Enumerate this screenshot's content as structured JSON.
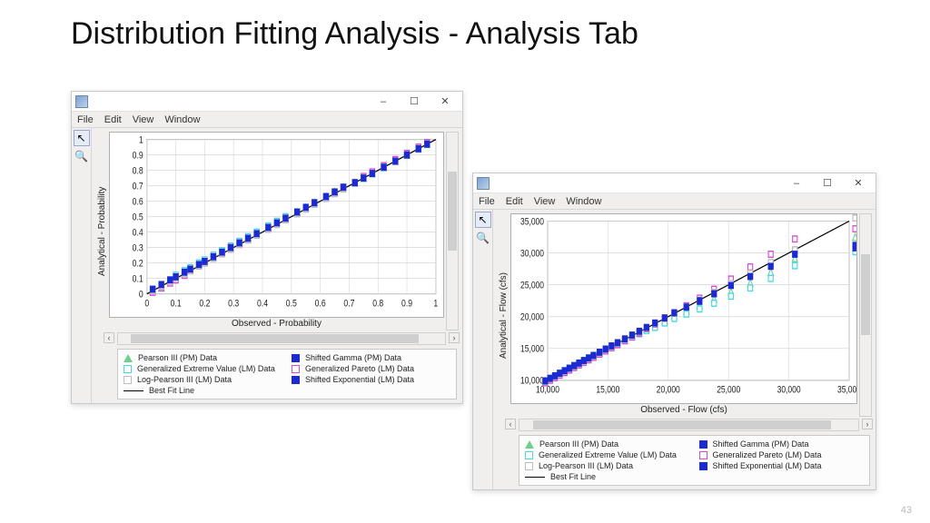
{
  "slide": {
    "title": "Distribution Fitting Analysis - Analysis Tab",
    "page": "43"
  },
  "menus": [
    "File",
    "Edit",
    "View",
    "Window"
  ],
  "winctrl": {
    "minimize": "–",
    "maximize": "☐",
    "close": "✕"
  },
  "tools": {
    "pointer_glyph": "↖",
    "zoom_glyph": "🔍"
  },
  "legend_items": [
    {
      "name": "Pearson III (PM) Data",
      "style": "tri",
      "color": "#6fd08c"
    },
    {
      "name": "Shifted Gamma (PM) Data",
      "style": "fill",
      "color": "#1c2bd1"
    },
    {
      "name": "Generalized Extreme Value (LM) Data",
      "style": "outline",
      "color": "#47d7e6"
    },
    {
      "name": "Generalized Pareto (LM) Data",
      "style": "outline",
      "color": "#d64bd1"
    },
    {
      "name": "Log-Pearson III (LM) Data",
      "style": "outline",
      "color": "#bdbdbd"
    },
    {
      "name": "Shifted Exponential (LM) Data",
      "style": "fill",
      "color": "#1c2bd1"
    }
  ],
  "bestfit_label": "Best Fit Line",
  "chart_data": [
    {
      "id": "pp_plot",
      "type": "scatter",
      "title": "",
      "xlabel": "Observed - Probability",
      "ylabel": "Analytical - Probability",
      "xlim": [
        0,
        1
      ],
      "ylim": [
        0,
        1
      ],
      "x_ticks": [
        0,
        0.1,
        0.2,
        0.3,
        0.4,
        0.5,
        0.6,
        0.7,
        0.8,
        0.9,
        1
      ],
      "y_ticks": [
        0,
        0.1,
        0.2,
        0.3,
        0.4,
        0.5,
        0.6,
        0.7,
        0.8,
        0.9,
        1.0
      ],
      "bestfit": {
        "x": [
          0,
          1
        ],
        "y": [
          0,
          1
        ]
      },
      "series": [
        {
          "name": "Pearson III (PM) Data",
          "color": "#6fd08c",
          "style": "tri",
          "x": [
            0.02,
            0.05,
            0.08,
            0.1,
            0.13,
            0.15,
            0.18,
            0.2,
            0.23,
            0.26,
            0.29,
            0.32,
            0.35,
            0.38,
            0.42,
            0.45,
            0.48,
            0.52,
            0.55,
            0.58,
            0.62,
            0.65,
            0.68,
            0.72,
            0.75,
            0.78,
            0.82,
            0.86,
            0.9,
            0.94,
            0.97
          ],
          "y": [
            0.02,
            0.04,
            0.08,
            0.1,
            0.13,
            0.16,
            0.19,
            0.21,
            0.24,
            0.27,
            0.3,
            0.33,
            0.36,
            0.39,
            0.43,
            0.46,
            0.49,
            0.53,
            0.56,
            0.59,
            0.63,
            0.66,
            0.69,
            0.72,
            0.75,
            0.78,
            0.82,
            0.86,
            0.9,
            0.94,
            0.97
          ]
        },
        {
          "name": "Shifted Gamma (PM) Data",
          "color": "#1c2bd1",
          "style": "fill",
          "x": [
            0.02,
            0.05,
            0.08,
            0.1,
            0.13,
            0.15,
            0.18,
            0.2,
            0.23,
            0.26,
            0.29,
            0.32,
            0.35,
            0.38,
            0.42,
            0.45,
            0.48,
            0.52,
            0.55,
            0.58,
            0.62,
            0.65,
            0.68,
            0.72,
            0.75,
            0.78,
            0.82,
            0.86,
            0.9,
            0.94,
            0.97
          ],
          "y": [
            0.02,
            0.05,
            0.08,
            0.11,
            0.14,
            0.16,
            0.19,
            0.21,
            0.24,
            0.27,
            0.3,
            0.33,
            0.36,
            0.39,
            0.43,
            0.46,
            0.49,
            0.53,
            0.56,
            0.59,
            0.63,
            0.66,
            0.69,
            0.72,
            0.75,
            0.78,
            0.82,
            0.86,
            0.9,
            0.94,
            0.97
          ]
        },
        {
          "name": "Generalized Extreme Value (LM) Data",
          "color": "#47d7e6",
          "style": "outline",
          "x": [
            0.02,
            0.05,
            0.08,
            0.1,
            0.13,
            0.15,
            0.18,
            0.2,
            0.23,
            0.26,
            0.29,
            0.32,
            0.35,
            0.38,
            0.42,
            0.45,
            0.48,
            0.52,
            0.55,
            0.58,
            0.62,
            0.65,
            0.68,
            0.72,
            0.75,
            0.78,
            0.82,
            0.86,
            0.9,
            0.94,
            0.97
          ],
          "y": [
            0.03,
            0.06,
            0.09,
            0.12,
            0.15,
            0.17,
            0.2,
            0.22,
            0.25,
            0.28,
            0.31,
            0.34,
            0.37,
            0.4,
            0.44,
            0.47,
            0.5,
            0.53,
            0.56,
            0.59,
            0.63,
            0.66,
            0.69,
            0.72,
            0.75,
            0.78,
            0.82,
            0.86,
            0.9,
            0.94,
            0.97
          ]
        },
        {
          "name": "Generalized Pareto (LM) Data",
          "color": "#d64bd1",
          "style": "outline",
          "x": [
            0.02,
            0.05,
            0.08,
            0.1,
            0.13,
            0.15,
            0.18,
            0.2,
            0.23,
            0.26,
            0.29,
            0.32,
            0.35,
            0.38,
            0.42,
            0.45,
            0.48,
            0.52,
            0.55,
            0.58,
            0.62,
            0.65,
            0.68,
            0.72,
            0.75,
            0.78,
            0.82,
            0.86,
            0.9,
            0.94,
            0.97
          ],
          "y": [
            0.01,
            0.04,
            0.07,
            0.09,
            0.12,
            0.15,
            0.18,
            0.2,
            0.23,
            0.26,
            0.29,
            0.32,
            0.35,
            0.38,
            0.42,
            0.45,
            0.48,
            0.52,
            0.55,
            0.58,
            0.62,
            0.65,
            0.69,
            0.72,
            0.76,
            0.79,
            0.83,
            0.87,
            0.91,
            0.95,
            0.98
          ]
        },
        {
          "name": "Log-Pearson III (LM) Data",
          "color": "#bdbdbd",
          "style": "outline",
          "x": [
            0.02,
            0.05,
            0.08,
            0.1,
            0.13,
            0.15,
            0.18,
            0.2,
            0.23,
            0.26,
            0.29,
            0.32,
            0.35,
            0.38,
            0.42,
            0.45,
            0.48,
            0.52,
            0.55,
            0.58,
            0.62,
            0.65,
            0.68,
            0.72,
            0.75,
            0.78,
            0.82,
            0.86,
            0.9,
            0.94,
            0.97
          ],
          "y": [
            0.02,
            0.05,
            0.08,
            0.1,
            0.13,
            0.15,
            0.18,
            0.2,
            0.23,
            0.26,
            0.29,
            0.32,
            0.35,
            0.38,
            0.42,
            0.45,
            0.48,
            0.52,
            0.55,
            0.58,
            0.62,
            0.65,
            0.68,
            0.72,
            0.75,
            0.78,
            0.82,
            0.86,
            0.9,
            0.94,
            0.97
          ]
        },
        {
          "name": "Shifted Exponential (LM) Data",
          "color": "#1c2bd1",
          "style": "fill",
          "x": [
            0.02,
            0.05,
            0.08,
            0.1,
            0.13,
            0.15,
            0.18,
            0.2,
            0.23,
            0.26,
            0.29,
            0.32,
            0.35,
            0.38,
            0.42,
            0.45,
            0.48,
            0.52,
            0.55,
            0.58,
            0.62,
            0.65,
            0.68,
            0.72,
            0.75,
            0.78,
            0.82,
            0.86,
            0.9,
            0.94,
            0.97
          ],
          "y": [
            0.03,
            0.06,
            0.09,
            0.11,
            0.14,
            0.16,
            0.19,
            0.21,
            0.24,
            0.27,
            0.3,
            0.33,
            0.36,
            0.39,
            0.43,
            0.46,
            0.49,
            0.53,
            0.56,
            0.59,
            0.63,
            0.66,
            0.69,
            0.72,
            0.75,
            0.78,
            0.82,
            0.86,
            0.9,
            0.94,
            0.97
          ]
        }
      ]
    },
    {
      "id": "qq_plot",
      "type": "scatter",
      "title": "",
      "xlabel": "Observed - Flow (cfs)",
      "ylabel": "Analytical - Flow (cfs)",
      "xlim": [
        10000,
        35000
      ],
      "ylim": [
        10000,
        35000
      ],
      "x_ticks": [
        10000,
        15000,
        20000,
        25000,
        30000,
        35000
      ],
      "y_ticks": [
        10000,
        15000,
        20000,
        25000,
        30000,
        35000
      ],
      "tick_format": "comma",
      "bestfit": {
        "x": [
          10000,
          35000
        ],
        "y": [
          10000,
          35000
        ]
      },
      "series": [
        {
          "name": "Pearson III (PM) Data",
          "color": "#6fd08c",
          "style": "tri",
          "x": [
            9800,
            10200,
            10600,
            11000,
            11400,
            11800,
            12200,
            12600,
            13000,
            13400,
            13800,
            14300,
            14800,
            15300,
            15800,
            16400,
            17000,
            17600,
            18200,
            18900,
            19700,
            20500,
            21500,
            22600,
            23800,
            25200,
            26800,
            28500,
            30500,
            35500
          ],
          "y": [
            9800,
            10200,
            10600,
            11000,
            11400,
            11800,
            12200,
            12600,
            13000,
            13400,
            13800,
            14300,
            14800,
            15300,
            15800,
            16300,
            16900,
            17500,
            18100,
            18700,
            19400,
            20100,
            20900,
            21800,
            22800,
            23900,
            25300,
            27000,
            29200,
            32500
          ]
        },
        {
          "name": "Shifted Gamma (PM) Data",
          "color": "#1c2bd1",
          "style": "fill",
          "x": [
            9800,
            10200,
            10600,
            11000,
            11400,
            11800,
            12200,
            12600,
            13000,
            13400,
            13800,
            14300,
            14800,
            15300,
            15800,
            16400,
            17000,
            17600,
            18200,
            18900,
            19700,
            20500,
            21500,
            22600,
            23800,
            25200,
            26800,
            28500,
            30500,
            35500
          ],
          "y": [
            9700,
            10100,
            10500,
            10900,
            11300,
            11700,
            12100,
            12500,
            12900,
            13300,
            13700,
            14200,
            14700,
            15200,
            15700,
            16300,
            16900,
            17500,
            18100,
            18800,
            19600,
            20400,
            21300,
            22400,
            23600,
            25000,
            26500,
            28300,
            30400,
            31200
          ]
        },
        {
          "name": "Generalized Extreme Value (LM) Data",
          "color": "#47d7e6",
          "style": "outline",
          "x": [
            9800,
            10200,
            10600,
            11000,
            11400,
            11800,
            12200,
            12600,
            13000,
            13400,
            13800,
            14300,
            14800,
            15300,
            15800,
            16400,
            17000,
            17600,
            18200,
            18900,
            19700,
            20500,
            21500,
            22600,
            23800,
            25200,
            26800,
            28500,
            30500,
            35500
          ],
          "y": [
            9900,
            10300,
            10700,
            11100,
            11500,
            11900,
            12300,
            12700,
            13100,
            13500,
            13900,
            14400,
            14900,
            15300,
            15800,
            16300,
            16800,
            17300,
            17800,
            18300,
            19000,
            19700,
            20400,
            21200,
            22100,
            23200,
            24500,
            26000,
            28000,
            30200
          ]
        },
        {
          "name": "Generalized Pareto (LM) Data",
          "color": "#d64bd1",
          "style": "outline",
          "x": [
            9800,
            10200,
            10600,
            11000,
            11400,
            11800,
            12200,
            12600,
            13000,
            13400,
            13800,
            14300,
            14800,
            15300,
            15800,
            16400,
            17000,
            17600,
            18200,
            18900,
            19700,
            20500,
            21500,
            22600,
            23800,
            25200,
            26800,
            28500,
            30500,
            35500
          ],
          "y": [
            9600,
            10000,
            10400,
            10800,
            11200,
            11600,
            12000,
            12400,
            12800,
            13200,
            13600,
            14100,
            14600,
            15100,
            15600,
            16200,
            16800,
            17400,
            18100,
            18800,
            19700,
            20600,
            21700,
            22900,
            24300,
            25900,
            27800,
            29800,
            32200,
            33800
          ]
        },
        {
          "name": "Log-Pearson III (LM) Data",
          "color": "#bdbdbd",
          "style": "outline",
          "x": [
            9800,
            10200,
            10600,
            11000,
            11400,
            11800,
            12200,
            12600,
            13000,
            13400,
            13800,
            14300,
            14800,
            15300,
            15800,
            16400,
            17000,
            17600,
            18200,
            18900,
            19700,
            20500,
            21500,
            22600,
            23800,
            25200,
            26800,
            28500,
            30500,
            35500
          ],
          "y": [
            9800,
            10200,
            10600,
            11000,
            11400,
            11800,
            12200,
            12600,
            13000,
            13400,
            13800,
            14300,
            14800,
            15300,
            15800,
            16400,
            17000,
            17600,
            18200,
            18900,
            19700,
            20500,
            21500,
            22600,
            23800,
            25200,
            26800,
            28500,
            30500,
            35500
          ]
        },
        {
          "name": "Shifted Exponential (LM) Data",
          "color": "#1c2bd1",
          "style": "fill",
          "x": [
            9800,
            10200,
            10600,
            11000,
            11400,
            11800,
            12200,
            12600,
            13000,
            13400,
            13800,
            14300,
            14800,
            15300,
            15800,
            16400,
            17000,
            17600,
            18200,
            18900,
            19700,
            20500,
            21500,
            22600,
            23800,
            25200,
            26800,
            28500,
            30500,
            35500
          ],
          "y": [
            9900,
            10300,
            10700,
            11100,
            11500,
            11900,
            12300,
            12700,
            13100,
            13500,
            13900,
            14400,
            14900,
            15400,
            15900,
            16500,
            17100,
            17700,
            18300,
            19000,
            19800,
            20600,
            21500,
            22500,
            23600,
            24900,
            26300,
            27900,
            29800,
            30800
          ]
        }
      ]
    }
  ]
}
